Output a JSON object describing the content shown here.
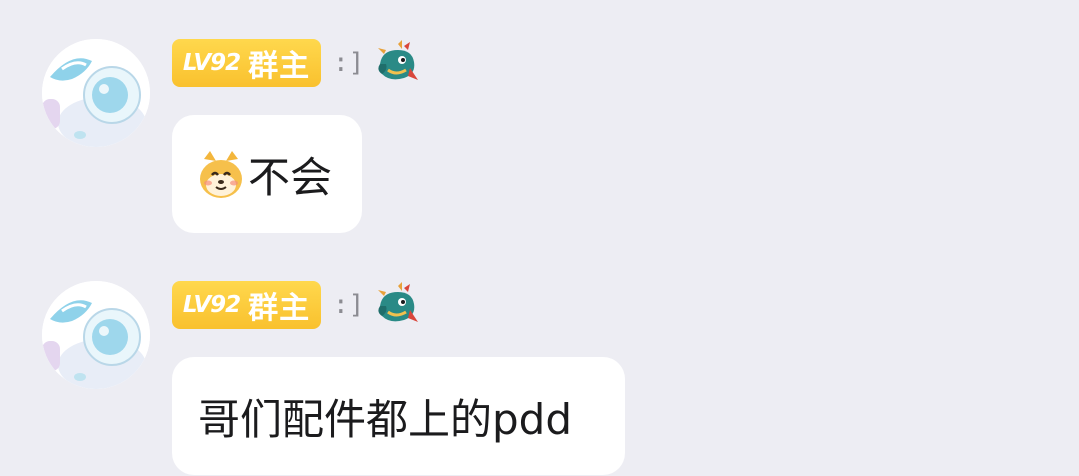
{
  "messages": [
    {
      "level_badge": "LV92",
      "role_badge": "群主",
      "emote_code": ":]",
      "avatar_icon": "water-drop-character-avatar",
      "title_icon": "dragon-icon",
      "emoji_icon": "cat-face-emoji",
      "text": "不会"
    },
    {
      "level_badge": "LV92",
      "role_badge": "群主",
      "emote_code": ":]",
      "avatar_icon": "water-drop-character-avatar",
      "title_icon": "dragon-icon",
      "text": "哥们配件都上的pdd"
    }
  ],
  "colors": {
    "background": "#EDEDF3",
    "badge_gold": "#FAC832",
    "bubble": "#FFFFFF",
    "text": "#1B1B1D"
  }
}
